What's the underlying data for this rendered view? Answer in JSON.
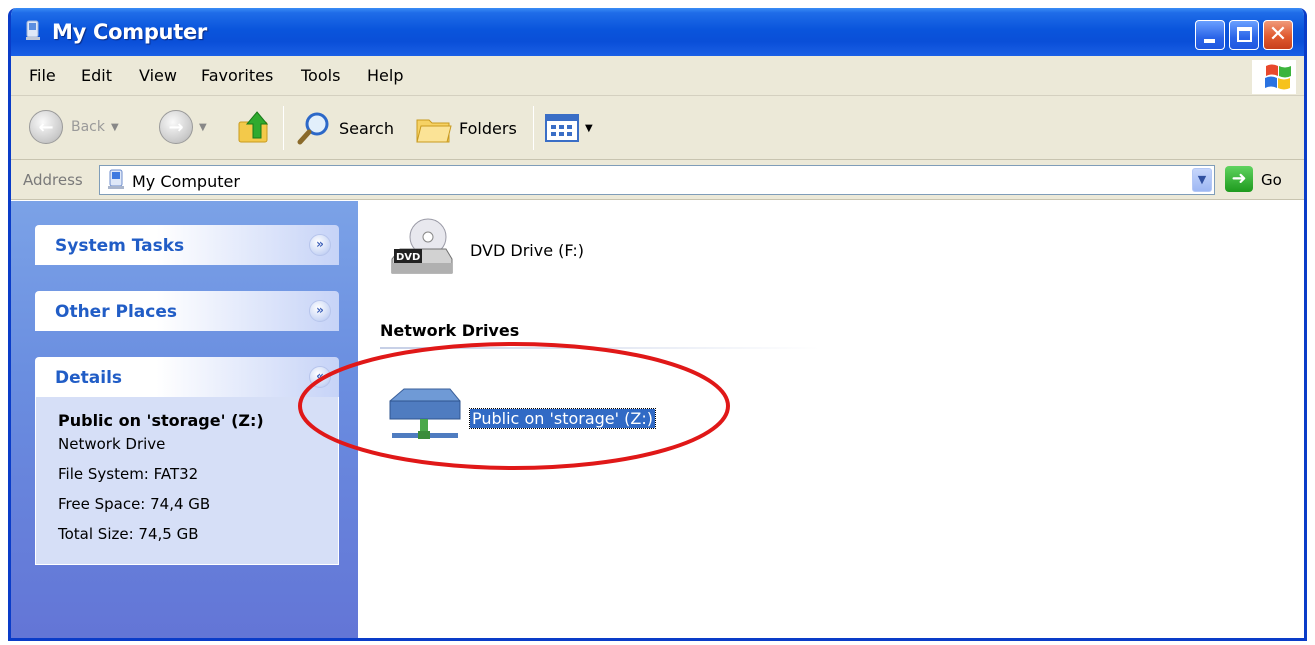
{
  "window": {
    "title": "My Computer",
    "accent_color": "#0a55dc",
    "buttons": {
      "minimize": "minimize",
      "maximize": "maximize",
      "close": "✕"
    }
  },
  "menu": {
    "items": [
      "File",
      "Edit",
      "View",
      "Favorites",
      "Tools",
      "Help"
    ]
  },
  "toolbar": {
    "back_label": "Back",
    "search_label": "Search",
    "folders_label": "Folders",
    "icons": [
      "back-arrow-icon",
      "forward-arrow-icon",
      "up-folder-icon",
      "search-icon",
      "folders-icon",
      "views-icon"
    ]
  },
  "address": {
    "label": "Address",
    "value": "My Computer",
    "go_label": "Go"
  },
  "left_pane": {
    "system_tasks": "System Tasks",
    "other_places": "Other Places",
    "details": {
      "title": "Details",
      "name": "Public on 'storage' (Z:)",
      "type": "Network Drive",
      "file_system": "File System: FAT32",
      "free_space": "Free Space: 74,4 GB",
      "total_size": "Total Size: 74,5 GB"
    }
  },
  "right_pane": {
    "dvd_label": "DVD Drive (F:)",
    "network_section": "Network Drives",
    "network_drive_label": "Public on 'storage' (Z:)",
    "highlight_color": "#316ac5",
    "annotation_color": "#e01818"
  }
}
